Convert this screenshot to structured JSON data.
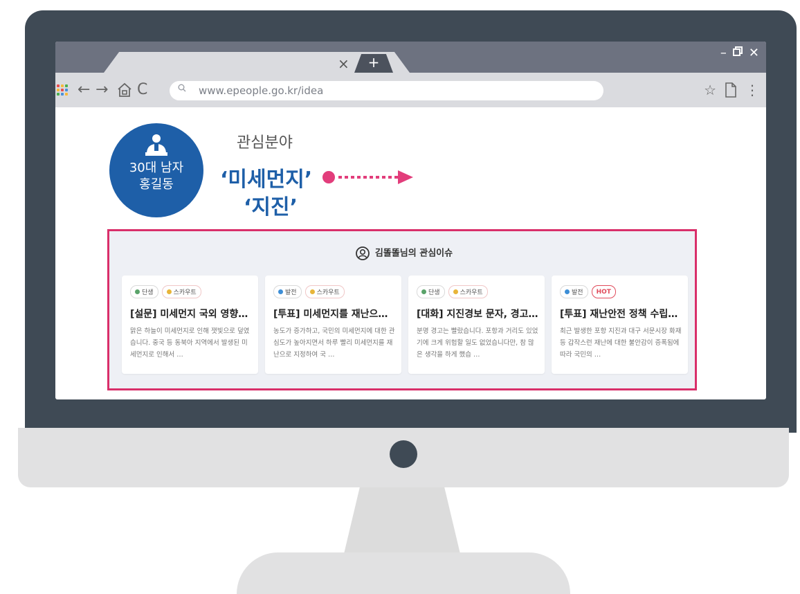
{
  "browser": {
    "url": "www.epeople.go.kr/idea"
  },
  "profile": {
    "line1": "30대 남자",
    "line2": "홍길동"
  },
  "interest": {
    "heading": "관심분야",
    "item1": "‘미세먼지’",
    "item2": "‘지진’"
  },
  "issues": {
    "title": "김똘똘님의 관심이슈",
    "cards": [
      {
        "tag1": "단생",
        "tag2": "스카우트",
        "title": "[설문] 미세먼지 국외 영향…",
        "body": "맑은 하늘이 미세먼지로 인해 잿빛으로 덮였습니다. 중국 등 동북아 지역에서 발생된 미세먼지로 인해서 …"
      },
      {
        "tag1": "발전",
        "tag2": "스카우트",
        "title": "[투표] 미세먼지를 재난으로…",
        "body": "농도가 증가하고, 국민의 미세먼지에 대한 관심도가 높아지면서 하루 빨리 미세먼지를 재난으로 지정하여 국 …"
      },
      {
        "tag1": "단생",
        "tag2": "스카우트",
        "title": "[대화] 지진경보 문자, 경고…",
        "body": "분명 경고는 빨랐습니다. 포항과 거리도 있었기에 크게 위험할 일도 없었습니다만, 참 많은 생각을 하게 했습 …"
      },
      {
        "tag1": "발전",
        "tag2": "HOT",
        "title": "[투표] 재난안전 정책 수립…",
        "body": "최근 발생한 포항 지진과 대구 서문시장 화재 등 갑작스런 재난에 대한 불안감이 증폭됨에 따라 국민의 …"
      }
    ]
  },
  "colors": {
    "frame": "#3f4a55",
    "accent_blue": "#1e5fa8",
    "highlight_pink": "#d92f6a"
  }
}
